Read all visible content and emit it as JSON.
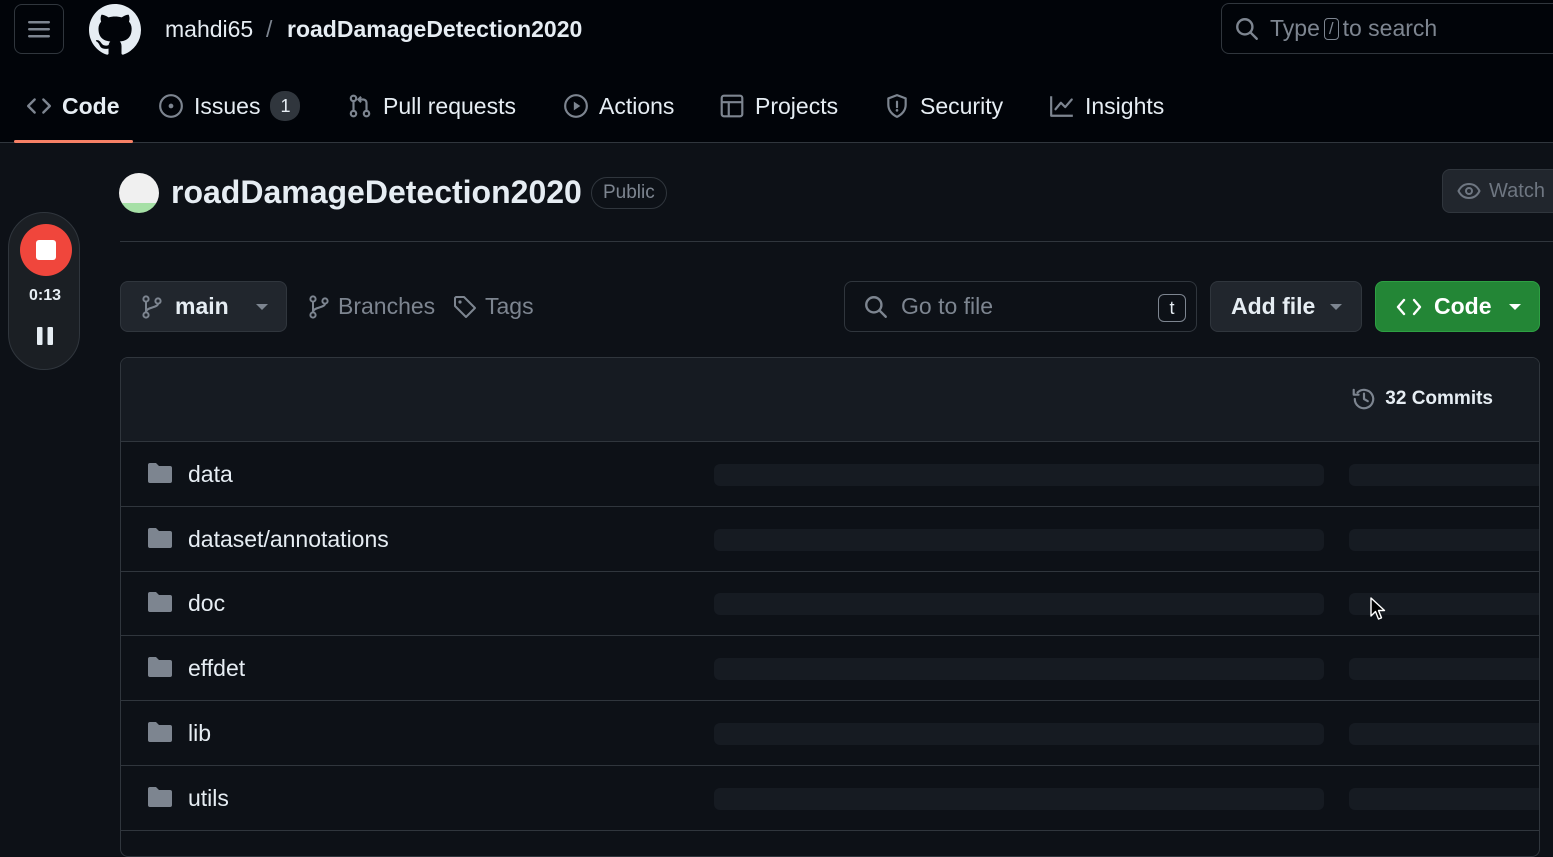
{
  "header": {
    "owner": "mahdi65",
    "separator": "/",
    "repo": "roadDamageDetection2020",
    "search_placeholder_pre": "Type",
    "search_key": "/",
    "search_placeholder_post": "to search"
  },
  "tabs": [
    {
      "label": "Code",
      "icon": "code-icon",
      "active": true
    },
    {
      "label": "Issues",
      "icon": "issue-icon",
      "count": "1"
    },
    {
      "label": "Pull requests",
      "icon": "pull-request-icon"
    },
    {
      "label": "Actions",
      "icon": "play-icon"
    },
    {
      "label": "Projects",
      "icon": "table-icon"
    },
    {
      "label": "Security",
      "icon": "shield-icon"
    },
    {
      "label": "Insights",
      "icon": "graph-icon"
    }
  ],
  "recorder": {
    "time": "0:13"
  },
  "repo": {
    "title": "roadDamageDetection2020",
    "visibility": "Public",
    "watch_label": "Watch"
  },
  "toolbar": {
    "branch": "main",
    "branches_label": "Branches",
    "tags_label": "Tags",
    "goto_placeholder": "Go to file",
    "goto_key": "t",
    "add_file_label": "Add file",
    "code_label": "Code"
  },
  "commits_label": "32 Commits",
  "files": [
    {
      "name": "data",
      "type": "folder"
    },
    {
      "name": "dataset/annotations",
      "type": "folder"
    },
    {
      "name": "doc",
      "type": "folder"
    },
    {
      "name": "effdet",
      "type": "folder"
    },
    {
      "name": "lib",
      "type": "folder"
    },
    {
      "name": "utils",
      "type": "folder"
    }
  ],
  "colors": {
    "background": "#0d1117",
    "header": "#010409",
    "accent_underline": "#f78166",
    "code_button": "#238636",
    "record_button": "#f0463c"
  }
}
